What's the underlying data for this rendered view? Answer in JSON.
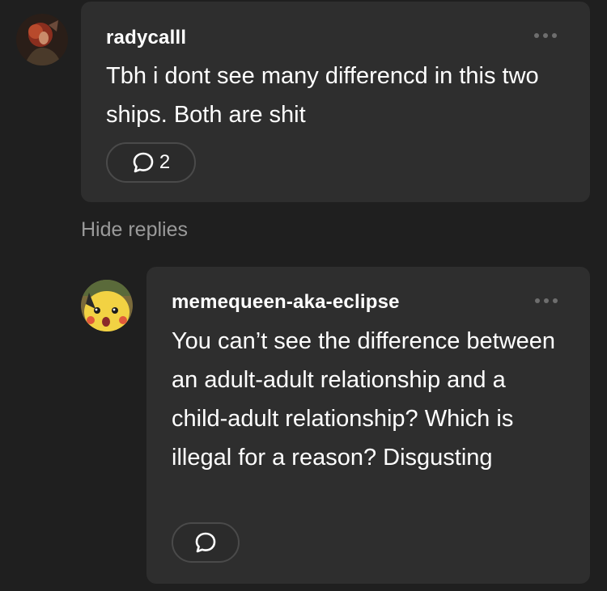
{
  "comments": [
    {
      "username": "radycalll",
      "text": "Tbh i dont see many differencd in this two ships. Both are shit",
      "reply_count": "2",
      "avatar_icon": "profile-photo"
    }
  ],
  "replies_toggle": "Hide replies",
  "replies": [
    {
      "username": "memequeen-aka-eclipse",
      "text": "You can’t see the difference between an adult-adult relationship and a child-adult relationship? Which is illegal for a reason? Disgusting",
      "reply_count": "",
      "avatar_icon": "surprised-pikachu"
    }
  ],
  "colors": {
    "background": "#1f1f1f",
    "card": "#2e2e2e",
    "muted": "#9a9a9a"
  }
}
